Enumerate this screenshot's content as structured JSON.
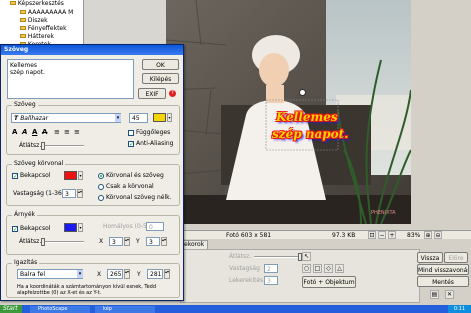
{
  "tree": {
    "items": [
      "Képszerkesztés",
      "AAAAAAAAA M",
      "Diszek",
      "Fényeffektek",
      "Hátterek",
      "Keretek"
    ]
  },
  "photo": {
    "overlay_line1": "Kellemes",
    "overlay_line2": "szép napot.",
    "watermark": "PHENIXTA"
  },
  "dialog": {
    "title": "Szöveg",
    "text_value": "Kellemes\nszép napot.",
    "ok": "OK",
    "cancel": "Kilépés",
    "exif": "EXIF",
    "szoveg_group": "Szöveg",
    "font": "Ballhazar",
    "size": "45",
    "fuggoleges": "Függőleges",
    "anti": "Anti-Aliasing",
    "atlatsz": "Átlátsz.",
    "kor_group": "Szöveg körvonal",
    "bekapcsol": "Bekapcsol",
    "vastagsag": "Vastagság (1-36)",
    "vast_val": "3",
    "r1": "Körvonal és szöveg",
    "r2": "Csak a körvonal",
    "r3": "Körvonal szöveg nélk.",
    "arnyek_group": "Árnyék",
    "bekapcsol2": "Bekapcsol",
    "homalyos": "Homályos (0-5)",
    "homalyos_val": "0",
    "atl2": "Átlátsz.",
    "x_lbl": "X",
    "x_val": "3",
    "y_lbl": "Y",
    "y_val": "3",
    "igaz_group": "Igazítás",
    "align": "Balra fel",
    "ix": "265",
    "iy": "281",
    "hint": "Ha a koordináták a számtartományon kívül esnek, Tedd alapfelzottbe (0) az X-et és az Y-t."
  },
  "status": {
    "size": "Fotó 603 x 581",
    "kb": "97.3 KB",
    "zoom": "83%"
  },
  "tabs": {
    "dekor": "ekorok"
  },
  "lower": {
    "atlatsz": "Átlátsz.",
    "vastagsag": "Vastagság",
    "lekerek": "Lekerekítés",
    "v1": "2",
    "v2": "3",
    "foto_objektum": "Fotó + Objektum",
    "vissza": "Vissza",
    "elore": "Előre",
    "mind": "Mind visszavonás",
    "mentes": "Mentés"
  },
  "taskbar": {
    "start": "Start",
    "app": "PhotoScape",
    "item2": "kép",
    "time": "0:11"
  },
  "colors": {
    "text_yellow": "#f6d400",
    "outline_red": "#ee1111",
    "shadow_blue": "#1a1aee"
  }
}
